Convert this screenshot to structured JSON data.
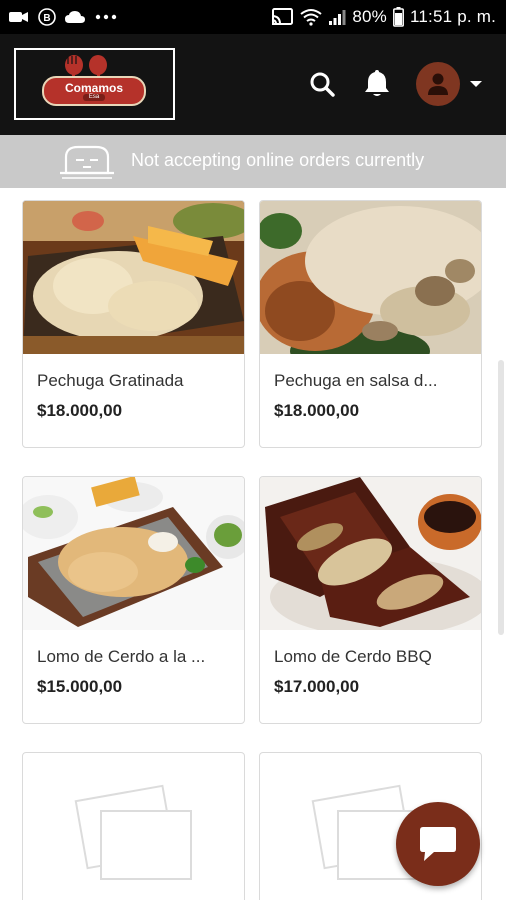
{
  "status_bar": {
    "battery": "80%",
    "time": "11:51 p. m."
  },
  "header": {
    "logo_text": "Comamos",
    "logo_sub": "Esa"
  },
  "banner": {
    "message": "Not accepting online orders currently"
  },
  "products": [
    {
      "name": "Pechuga Gratinada",
      "price": "$18.000,00"
    },
    {
      "name": "Pechuga en salsa d...",
      "price": "$18.000,00"
    },
    {
      "name": "Lomo de Cerdo a la ...",
      "price": "$15.000,00"
    },
    {
      "name": "Lomo de Cerdo BBQ",
      "price": "$17.000,00"
    }
  ],
  "colors": {
    "header_bg": "#131313",
    "banner_bg": "#c9c9c9",
    "accent": "#7a2d1a"
  },
  "icons": [
    "camera-icon",
    "b-app-icon",
    "cloud-icon",
    "more-icon",
    "cast-icon",
    "wifi-icon",
    "signal-icon",
    "battery-icon",
    "search-icon",
    "bell-icon",
    "user-icon",
    "caret-down-icon",
    "closed-store-icon",
    "chat-icon",
    "image-placeholder-icon"
  ]
}
